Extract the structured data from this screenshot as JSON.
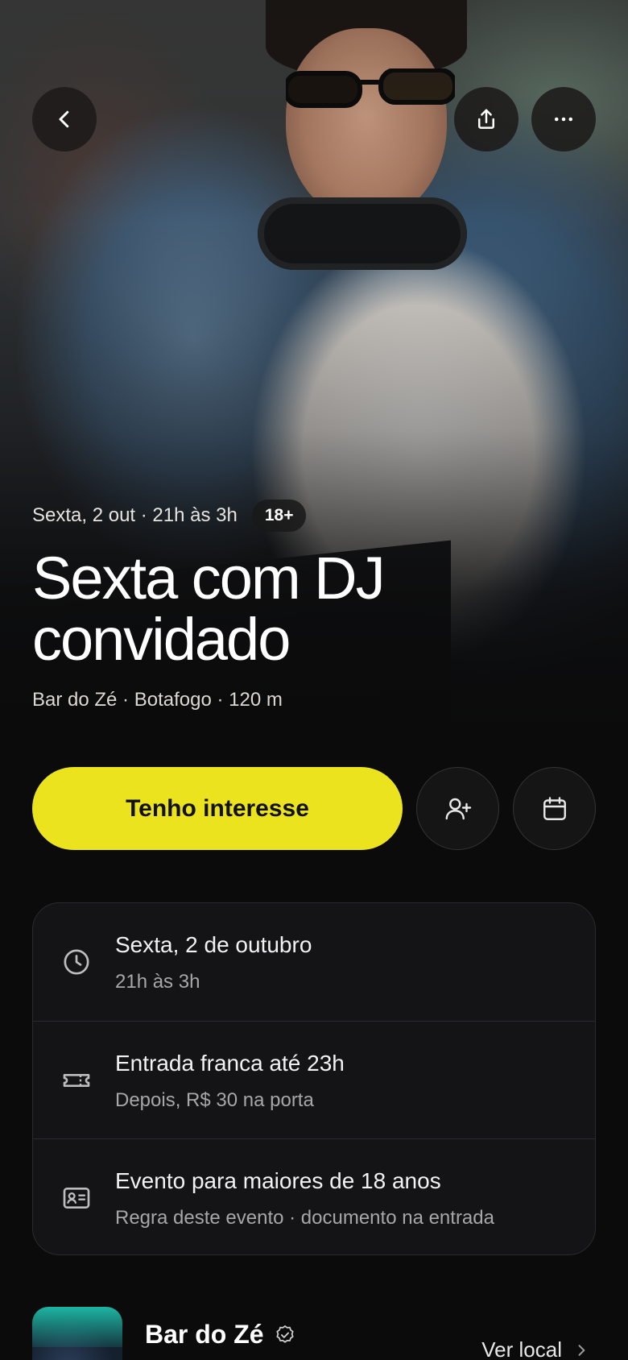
{
  "hero": {
    "image_alt": "DJ de óculos e jaqueta jeans com fones no pescoço",
    "back_icon": "chevron-left-icon",
    "share_icon": "share-icon",
    "more_icon": "more-horizontal-icon"
  },
  "event": {
    "when": "Sexta, 2 out · 21h às 3h",
    "age_badge": "18+",
    "title": "Sexta com DJ convidado",
    "venue_line": "Bar do Zé · Botafogo · 120 m"
  },
  "actions": {
    "interest_label": "Tenho interesse",
    "invite_icon": "user-plus-icon",
    "calendar_icon": "calendar-icon",
    "accent_color": "#ECE31F"
  },
  "details": [
    {
      "icon": "clock-icon",
      "title": "Sexta, 2 de outubro",
      "subtitle": "21h às 3h"
    },
    {
      "icon": "ticket-icon",
      "title": "Entrada franca até 23h",
      "subtitle": "Depois, R$ 30 na porta"
    },
    {
      "icon": "id-card-icon",
      "title": "Evento para maiores de 18 anos",
      "subtitle": "Regra deste evento · documento na entrada"
    }
  ],
  "venue": {
    "name": "Bar do Zé",
    "verified_icon": "verified-badge-icon",
    "link_label": "Ver local"
  }
}
